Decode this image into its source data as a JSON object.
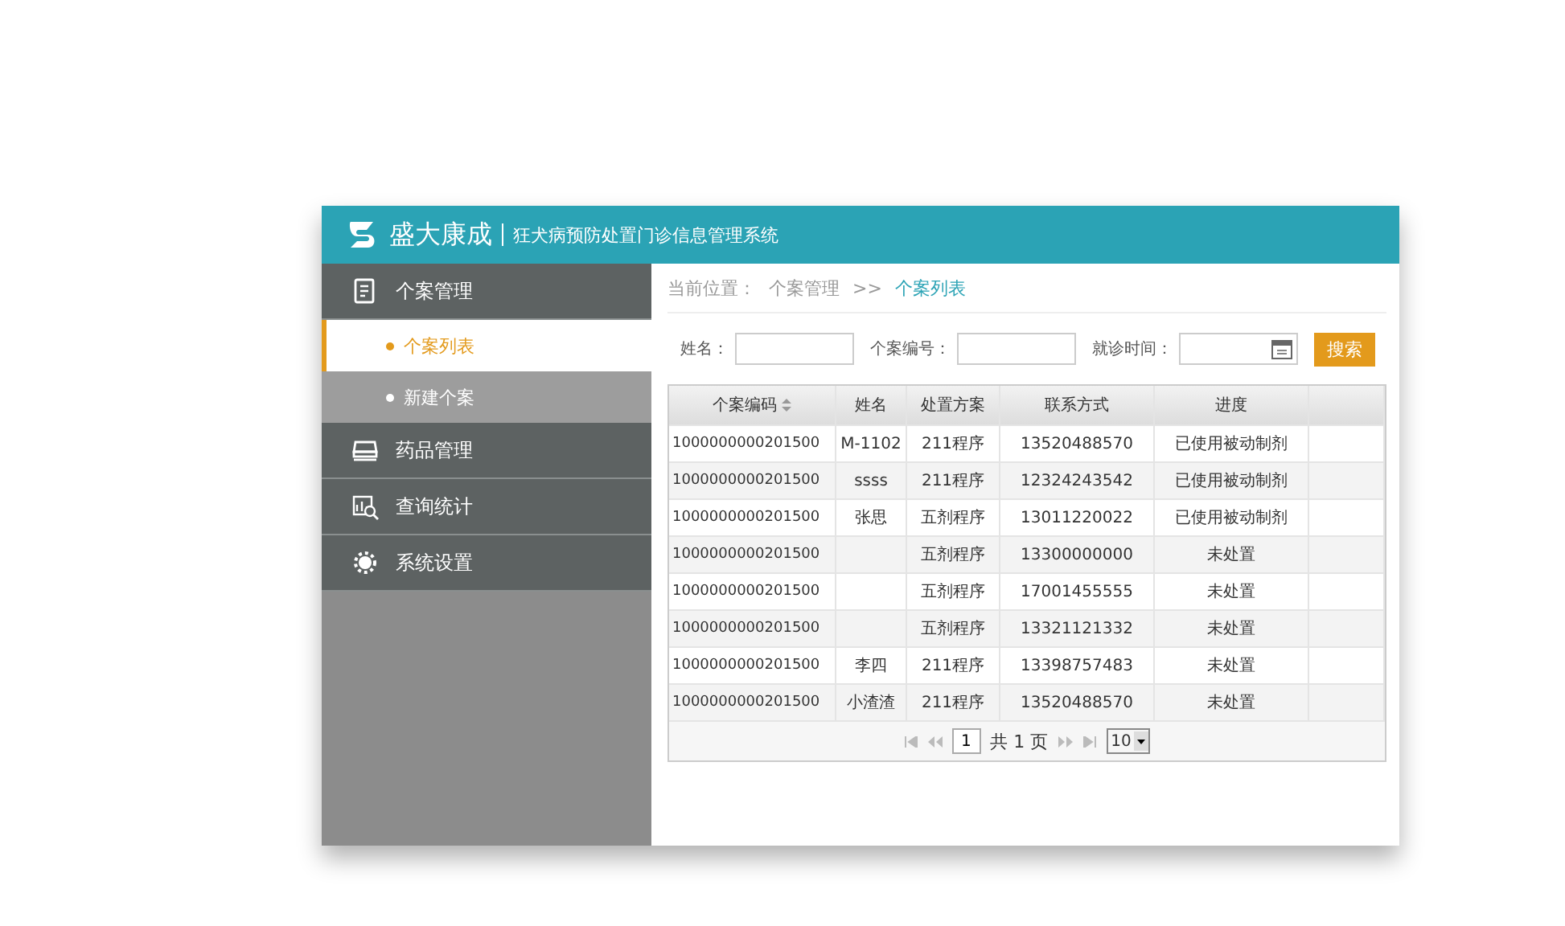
{
  "header": {
    "brand": "盛大康成",
    "subtitle": "狂犬病预防处置门诊信息管理系统"
  },
  "sidebar": {
    "items": [
      {
        "label": "个案管理",
        "children": [
          {
            "label": "个案列表",
            "selected": true
          },
          {
            "label": "新建个案",
            "selected": false
          }
        ]
      },
      {
        "label": "药品管理"
      },
      {
        "label": "查询统计"
      },
      {
        "label": "系统设置"
      }
    ]
  },
  "breadcrumb": {
    "label": "当前位置：",
    "separator": ">>",
    "items": [
      "个案管理",
      "个案列表"
    ]
  },
  "search": {
    "fields": [
      {
        "label": "姓名：",
        "kind": "text"
      },
      {
        "label": "个案编号：",
        "kind": "text"
      },
      {
        "label": "就诊时间：",
        "kind": "date"
      }
    ],
    "button": "搜索"
  },
  "table": {
    "columns": [
      {
        "label": "个案编码",
        "sortable": true
      },
      {
        "label": "姓名",
        "sortable": false
      },
      {
        "label": "处置方案",
        "sortable": false
      },
      {
        "label": "联系方式",
        "sortable": false
      },
      {
        "label": "进度",
        "sortable": false
      }
    ],
    "rows": [
      {
        "code": "1000000000201500",
        "name": "M-1102",
        "plan": "211程序",
        "phone": "13520488570",
        "progress": "已使用被动制剂"
      },
      {
        "code": "1000000000201500",
        "name": "ssss",
        "plan": "211程序",
        "phone": "12324243542",
        "progress": "已使用被动制剂"
      },
      {
        "code": "1000000000201500",
        "name": "张思",
        "plan": "五剂程序",
        "phone": "13011220022",
        "progress": "已使用被动制剂"
      },
      {
        "code": "1000000000201500",
        "plan": "五剂程序",
        "phone": "13300000000",
        "progress": "未处置"
      },
      {
        "code": "1000000000201500",
        "plan": "五剂程序",
        "phone": "17001455555",
        "progress": "未处置"
      },
      {
        "code": "1000000000201500",
        "plan": "五剂程序",
        "phone": "13321121332",
        "progress": "未处置"
      },
      {
        "code": "1000000000201500",
        "name": "李四",
        "plan": "211程序",
        "phone": "13398757483",
        "progress": "未处置"
      },
      {
        "code": "1000000000201500",
        "name": "小渣渣",
        "plan": "211程序",
        "phone": "13520488570",
        "progress": "未处置"
      }
    ]
  },
  "pager": {
    "page": "1",
    "total": "共 1 页",
    "page_size": "10"
  }
}
